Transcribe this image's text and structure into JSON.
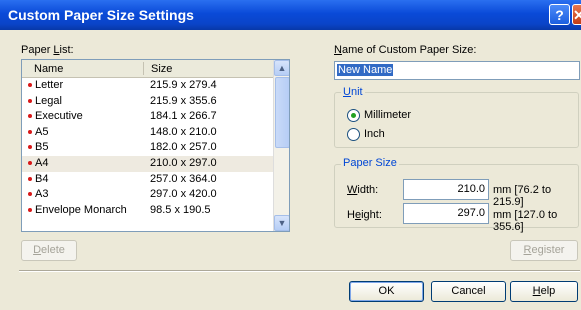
{
  "window": {
    "title": "Custom Paper Size Settings",
    "help_glyph": "?",
    "close_glyph": "✕"
  },
  "paper_list": {
    "label_pre": "Paper ",
    "label_key": "L",
    "label_post": "ist:",
    "columns": [
      "Name",
      "Size"
    ],
    "rows": [
      {
        "name": "Letter",
        "size": "215.9 x 279.4"
      },
      {
        "name": "Legal",
        "size": "215.9 x 355.6"
      },
      {
        "name": "Executive",
        "size": "184.1 x 266.7"
      },
      {
        "name": "A5",
        "size": "148.0 x 210.0"
      },
      {
        "name": "B5",
        "size": "182.0 x 257.0"
      },
      {
        "name": "A4",
        "size": "210.0 x 297.0"
      },
      {
        "name": "B4",
        "size": "257.0 x 364.0"
      },
      {
        "name": "A3",
        "size": "297.0 x 420.0"
      },
      {
        "name": "Envelope Monarch",
        "size": "98.5 x 190.5"
      }
    ],
    "selected_row": "A4"
  },
  "name_field": {
    "label_key": "N",
    "label_post": "ame of Custom Paper Size:",
    "value": "New Name"
  },
  "unit": {
    "title_key": "U",
    "title_post": "nit",
    "options": [
      "Millimeter",
      "Inch"
    ],
    "selected": "Millimeter"
  },
  "paper_size": {
    "title": "Paper Size",
    "width_key": "W",
    "width_post": "idth:",
    "width_value": "210.0",
    "width_hint": "mm [76.2 to 215.9]",
    "height_pre": "H",
    "height_key": "e",
    "height_post": "ight:",
    "height_value": "297.0",
    "height_hint": "mm [127.0 to 355.6]"
  },
  "buttons": {
    "delete_key": "D",
    "delete_post": "elete",
    "register_key": "R",
    "register_post": "egister",
    "ok": "OK",
    "cancel": "Cancel",
    "help_key": "H",
    "help_post": "elp"
  },
  "icons": [
    "help-icon",
    "close-icon",
    "scroll-up-icon",
    "scroll-down-icon",
    "list-bullet-icon",
    "radio-icon"
  ],
  "colors": {
    "titlebar": "#0a4ad8",
    "selection": "#316ac5",
    "bullet": "#d81818",
    "dialog": "#ece9d8"
  }
}
